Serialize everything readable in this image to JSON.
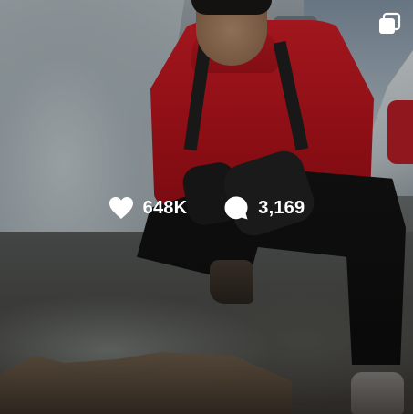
{
  "post": {
    "likes": "648K",
    "comments": "3,169"
  },
  "icons": {
    "like": "heart-icon",
    "comment": "comment-bubble-icon",
    "multi": "carousel-album-icon"
  },
  "colors": {
    "overlay_text": "#ffffff",
    "jacket": "#d01c25"
  }
}
